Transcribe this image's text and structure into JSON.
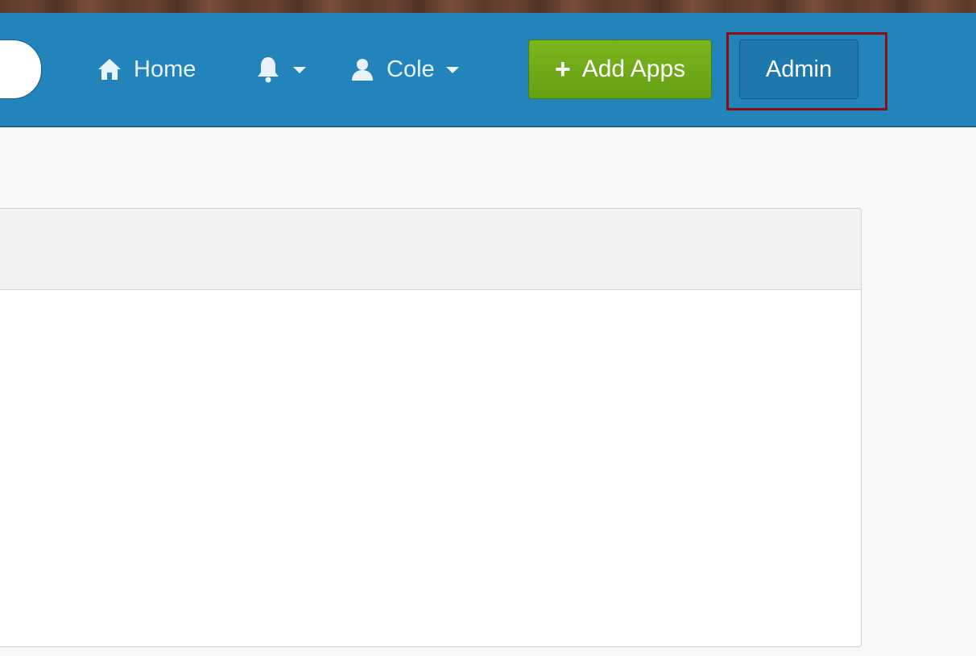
{
  "navbar": {
    "home_label": "Home",
    "user_label": "Cole",
    "add_apps_label": "Add Apps",
    "admin_label": "Admin"
  },
  "icons": {
    "home": "home-icon",
    "notifications": "bell-icon",
    "user": "user-icon",
    "add": "plus-icon"
  },
  "colors": {
    "navbar_bg": "#2384bb",
    "add_button": "#6fa818",
    "admin_button": "#1e78ad",
    "highlight": "#8b0d10"
  }
}
